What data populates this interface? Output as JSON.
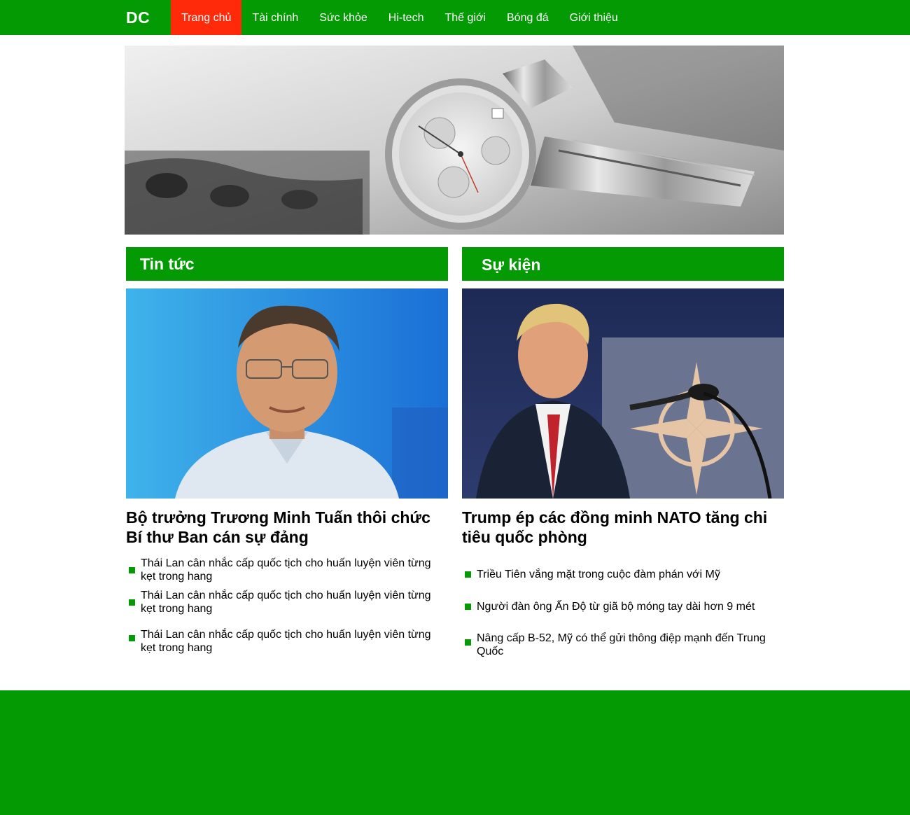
{
  "header": {
    "logo": "DC",
    "nav": [
      {
        "label": "Trang chủ",
        "active": true
      },
      {
        "label": "Tài chính",
        "active": false
      },
      {
        "label": "Sức khỏe",
        "active": false
      },
      {
        "label": "Hi-tech",
        "active": false
      },
      {
        "label": "Thế giới",
        "active": false
      },
      {
        "label": "Bóng đá",
        "active": false
      },
      {
        "label": "Giới thiệu",
        "active": false
      }
    ]
  },
  "banner": {
    "image": "watch-banner-image"
  },
  "sections": {
    "news": {
      "title": "Tin tức",
      "image": "minister-portrait-image",
      "headline": "Bộ trưởng Trương Minh Tuấn thôi chức Bí thư Ban cán sự đảng",
      "items": [
        "Thái Lan cân nhắc cấp quốc tịch cho huấn luyện viên từng kẹt trong hang",
        "Thái Lan cân nhắc cấp quốc tịch cho huấn luyện viên từng kẹt trong hang",
        "Thái Lan cân nhắc cấp quốc tịch cho huấn luyện viên từng kẹt trong hang"
      ]
    },
    "events": {
      "title": "Sự kiện",
      "image": "trump-nato-image",
      "headline": "Trump ép các đồng minh NATO tăng chi tiêu quốc phòng",
      "items": [
        "Triều Tiên vắng mặt trong cuộc đàm phán với Mỹ",
        "Người đàn ông Ấn Độ từ giã bộ móng tay dài hơn 9 mét",
        "Nâng cấp B-52, Mỹ có thể gửi thông điệp mạnh đến Trung Quốc"
      ]
    }
  },
  "colors": {
    "brand_green": "#039a03",
    "active_red": "#ff2a0a"
  }
}
